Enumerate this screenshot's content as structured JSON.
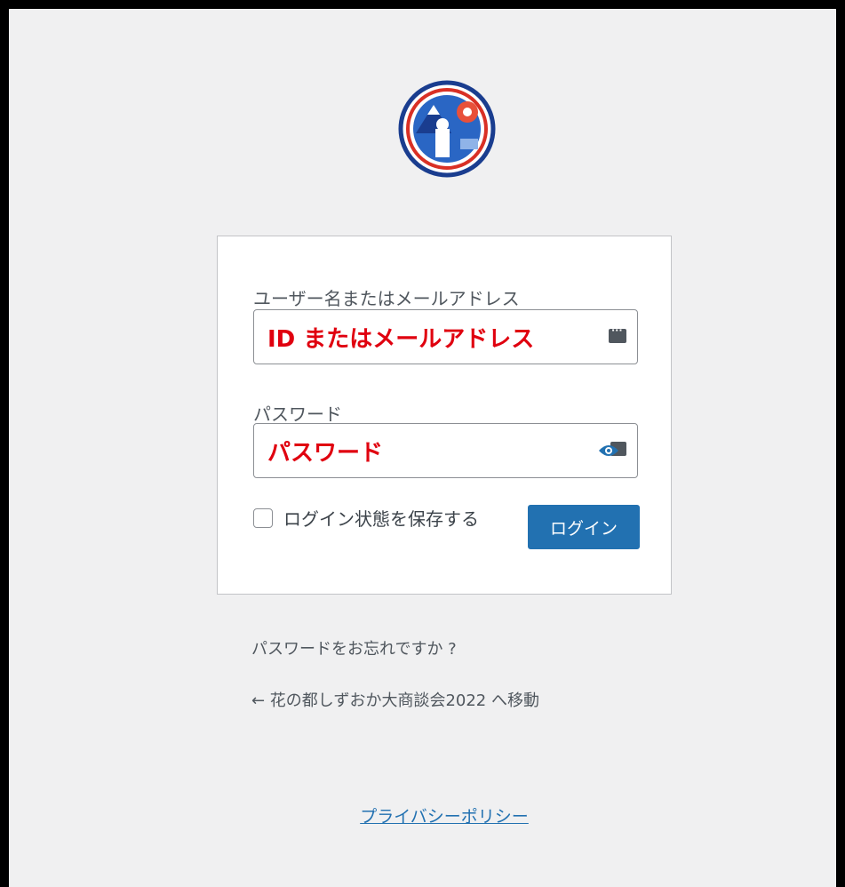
{
  "login_form": {
    "username_label": "ユーザー名またはメールアドレス",
    "username_value": "ID またはメールアドレス",
    "password_label": "パスワード",
    "password_value": "パスワード",
    "remember_label": "ログイン状態を保存する",
    "remember_checked": false,
    "submit_label": "ログイン"
  },
  "links": {
    "lost_password": "パスワードをお忘れですか ?",
    "back_to_site": "← 花の都しずおか大商談会2022 へ移動",
    "privacy_policy": "プライバシーポリシー"
  },
  "icons": {
    "logo": "site-logo-emblem",
    "username_field": "password-manager-keyboard-icon",
    "password_field": "show-password-eye-icon"
  },
  "colors": {
    "accent": "#2271b1",
    "field_text": "#e0000f",
    "background": "#f0f0f1"
  }
}
